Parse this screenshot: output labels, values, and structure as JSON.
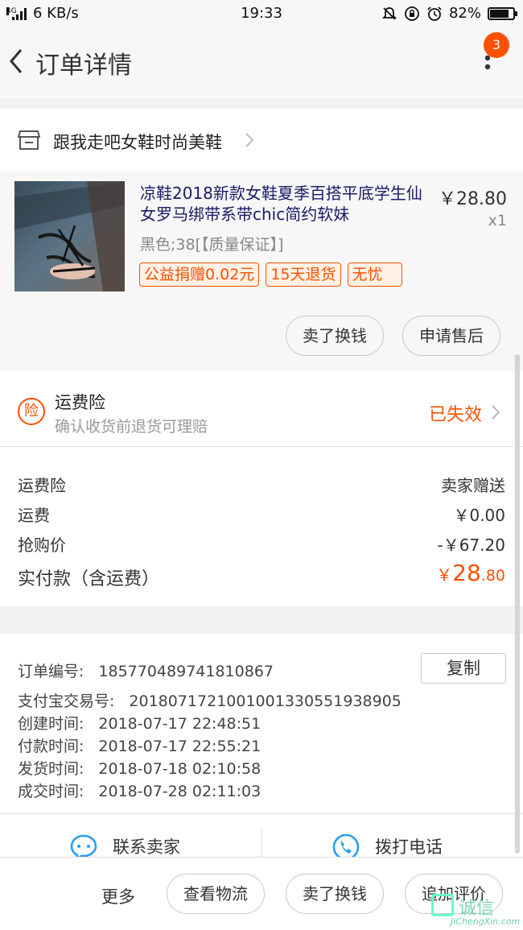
{
  "status_bar": {
    "network": "4G",
    "speed": "6 KB/s",
    "time": "19:33",
    "battery": "82%",
    "battery_level": 0.82,
    "icons": [
      "signal-icon",
      "mute-icon",
      "rotation-lock-icon",
      "alarm-icon",
      "battery-icon"
    ]
  },
  "nav": {
    "title": "订单详情",
    "badge_count": "3"
  },
  "shop": {
    "name": "跟我走吧女鞋时尚美鞋"
  },
  "item": {
    "title": "凉鞋2018新款女鞋夏季百搭平底学生仙女罗马绑带系带chic简约软妹",
    "price": "￥28.80",
    "quantity": "x1",
    "sku": "黑色;38[【质量保证】]",
    "tags": [
      "公益捐赠0.02元",
      "15天退货",
      "无忧"
    ],
    "buttons": {
      "sell": "卖了换钱",
      "after_sale": "申请售后"
    }
  },
  "insurance": {
    "icon_char": "险",
    "title": "运费险",
    "subtitle": "确认收货前退货可理赔",
    "status": "已失效"
  },
  "fees": [
    {
      "label": "运费险",
      "value": "卖家赠送"
    },
    {
      "label": "运费",
      "value": "￥0.00"
    },
    {
      "label": "抢购价",
      "value": "-￥67.20"
    }
  ],
  "total": {
    "label": "实付款（含运费）",
    "symbol": "￥",
    "integer": "28",
    "decimal": ".80"
  },
  "order_info": {
    "copy_label": "复制",
    "lines": [
      {
        "label": "订单编号:",
        "value": "185770489741810867"
      },
      {
        "label": "支付宝交易号:",
        "value": "2018071721001001330551938905"
      },
      {
        "label": "创建时间:",
        "value": "2018-07-17 22:48:51"
      },
      {
        "label": "付款时间:",
        "value": "2018-07-17 22:55:21"
      },
      {
        "label": "发货时间:",
        "value": "2018-07-18 02:10:58"
      },
      {
        "label": "成交时间:",
        "value": "2018-07-28 02:11:03"
      }
    ]
  },
  "contact": {
    "seller": "联系卖家",
    "phone": "拨打电话"
  },
  "bottom_bar": {
    "more": "更多",
    "logistics": "查看物流",
    "sell": "卖了换钱",
    "review": "追加评价"
  },
  "watermark": {
    "text": "诚信",
    "sub": "JiChengXin.com"
  },
  "colors": {
    "accent": "#ff5000",
    "link_title": "#1a1a66"
  }
}
